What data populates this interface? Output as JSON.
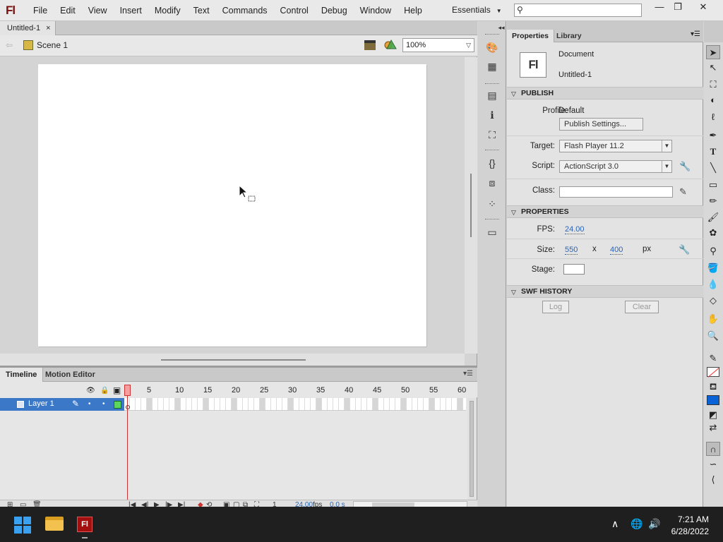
{
  "app": {
    "logo": "Fl"
  },
  "menu": [
    "File",
    "Edit",
    "View",
    "Insert",
    "Modify",
    "Text",
    "Commands",
    "Control",
    "Debug",
    "Window",
    "Help"
  ],
  "workspace": {
    "label": "Essentials"
  },
  "search": {
    "placeholder": ""
  },
  "window_controls": {
    "minimize": "—",
    "restore": "❐",
    "close": "✕"
  },
  "document": {
    "tab_label": "Untitled-1",
    "tab_close": "×",
    "scene": "Scene 1",
    "zoom": "100%"
  },
  "timeline": {
    "tabs": [
      "Timeline",
      "Motion Editor"
    ],
    "frame_numbers": [
      "1",
      "5",
      "10",
      "15",
      "20",
      "25",
      "30",
      "35",
      "40",
      "45",
      "50",
      "55",
      "60"
    ],
    "layer_name": "Layer 1",
    "footer": {
      "current_frame": "1",
      "fps": "24.00",
      "fps_unit": "fps",
      "elapsed": "0.0 s"
    }
  },
  "properties": {
    "tabs": [
      "Properties",
      "Library"
    ],
    "doc_icon_text": "Fl",
    "doc_kind": "Document",
    "doc_name": "Untitled-1",
    "publish": {
      "header": "PUBLISH",
      "profile_label": "Profile:",
      "profile_value": "Default",
      "publish_settings_button": "Publish Settings...",
      "target_label": "Target:",
      "target_value": "Flash Player 11.2",
      "script_label": "Script:",
      "script_value": "ActionScript 3.0",
      "class_label": "Class:"
    },
    "props": {
      "header": "PROPERTIES",
      "fps_label": "FPS:",
      "fps_value": "24.00",
      "size_label": "Size:",
      "width": "550",
      "x_sep": "x",
      "height": "400",
      "unit": "px",
      "stage_label": "Stage:",
      "stage_color": "#FFFFFF"
    },
    "swf_history": {
      "header": "SWF HISTORY",
      "log_button": "Log",
      "clear_button": "Clear"
    }
  },
  "taskbar": {
    "time": "7:21 AM",
    "date": "6/28/2022",
    "flash_label": "Fl"
  },
  "colors": {
    "fill": "#0A63D6",
    "stroke": "#FFFFFF",
    "selected_layer": "#3B78C7",
    "playhead": "#CC3333"
  }
}
